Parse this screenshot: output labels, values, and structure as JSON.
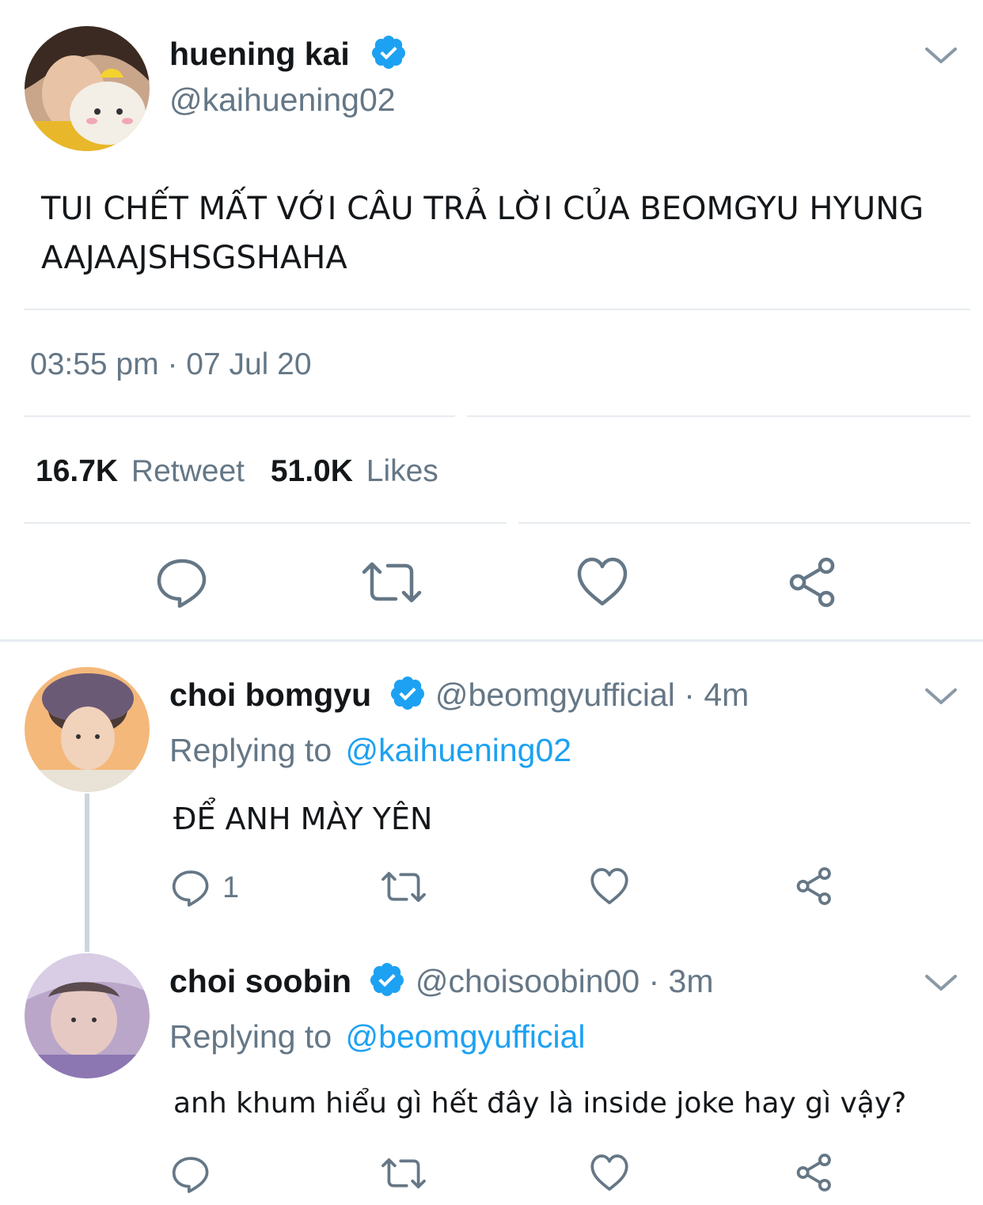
{
  "main_tweet": {
    "name": "huening kai",
    "handle": "@kaihuening02",
    "text_line1": "TUI CHẾT MẤT VỚI CÂU TRẢ LỜI CỦA BEOMGYU HYUNG",
    "text_line2": "AAJAAJSHSGSHAHA",
    "timestamp": "03:55 pm · 07 Jul 20",
    "retweet_count": "16.7K",
    "retweet_label": "Retweet",
    "likes_count": "51.0K",
    "likes_label": "Likes"
  },
  "replies": [
    {
      "name": "choi bomgyu",
      "handle": "@beomgyufficial",
      "time": " · 4m",
      "replying_label": "Replying to",
      "replying_to": "@kaihuening02",
      "text": "ĐỂ ANH MÀY YÊN",
      "reply_count": "1"
    },
    {
      "name": "choi soobin",
      "handle": "@choisoobin00",
      "time": " · 3m",
      "replying_label": "Replying to",
      "replying_to": "@beomgyufficial",
      "text": "anh khum hiểu gì hết đây là inside joke hay gì vậy?"
    }
  ],
  "colors": {
    "accent": "#1da1f2",
    "secondary_text": "#657786",
    "divider": "#e6ecf0",
    "icon": "#657786"
  },
  "icons": [
    "verified-badge-icon",
    "chevron-down-icon",
    "reply-icon",
    "retweet-icon",
    "like-icon",
    "share-icon"
  ]
}
